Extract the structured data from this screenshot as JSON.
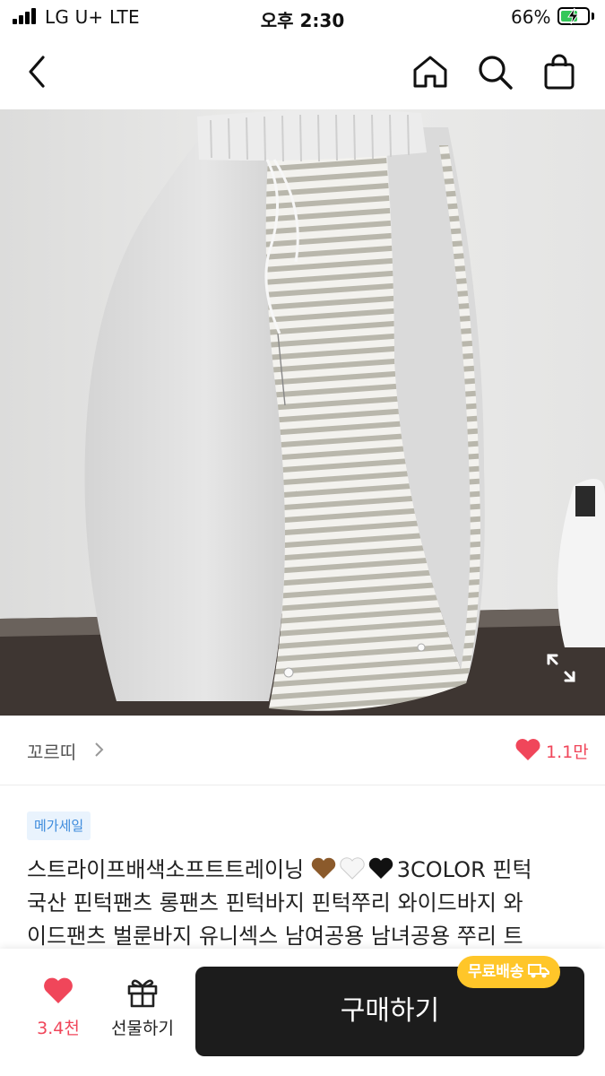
{
  "status_bar": {
    "carrier": "LG U+   LTE",
    "time": "오후 2:30",
    "battery": "66%",
    "battery_level": 0.66
  },
  "nav": {
    "icons": [
      "back-icon",
      "home-icon",
      "search-icon",
      "shopping-bag-icon"
    ]
  },
  "product": {
    "seller_name": "꼬르띠",
    "like_count": "1.1만",
    "badge": "메가세일",
    "title_lines": [
      "스트라이프배색소프트트레이닝",
      "🤎🤍🖤",
      "3COLOR 핀턱",
      "국산 핀턱팬츠 롱팬츠 핀턱바지 핀턱쭈리 와이드바지 와",
      "이드팬츠 벌룬바지 유니섹스 남여공용 남녀공용 쭈리 트"
    ]
  },
  "bottom_bar": {
    "wish_count": "3.4천",
    "gift_label": "선물하기",
    "buy_label": "구매하기",
    "free_shipping": "무료배송"
  },
  "colors": {
    "accent_red": "#f0465a",
    "badge_blue": "#3d8bdc",
    "free_yellow": "#ffc629",
    "buy_dark": "#1c1c1c"
  }
}
